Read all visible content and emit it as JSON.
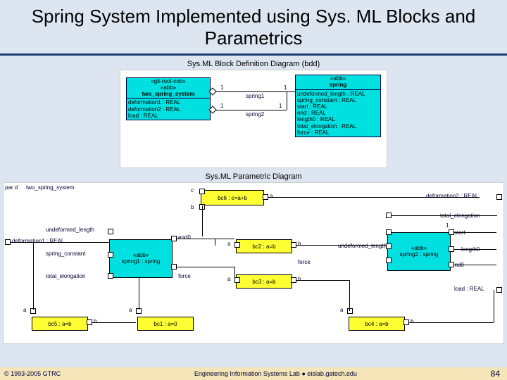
{
  "title": "Spring System Implemented using Sys. ML Blocks and Parametrics",
  "caption_bdd": "Sys.ML Block Definition Diagram (bdd)",
  "caption_par": "Sys.ML Parametric Diagram",
  "bdd": {
    "left_block": {
      "stereo1": "«git-root-cob»",
      "stereo2": "«abb»",
      "name": "two_spring_system",
      "attrs": [
        "deformation1 : REAL",
        "deformation2 : REAL",
        "load : REAL"
      ]
    },
    "right_block": {
      "stereo": "«abb»",
      "name": "spring",
      "attrs": [
        "undeformed_length : REAL",
        "spring_constant : REAL",
        "start : REAL",
        "end : REAL",
        "length0 : REAL",
        "total_elongation : REAL",
        "force : REAL"
      ]
    },
    "assoc": {
      "spring1": "spring1",
      "spring2": "spring2",
      "one_a": "1",
      "one_b": "1",
      "one_c": "1",
      "one_d": "1"
    }
  },
  "par": {
    "frame": "par  d",
    "context": "two_spring_system",
    "left_values": {
      "def1": "deformation1 : REAL",
      "undef": "undeformed_length",
      "spring_const": "spring_constant",
      "total_elong": "total_elongation"
    },
    "right_values": {
      "def2": "deformation2 : REAL",
      "total_elong": "total_elongation",
      "start": "start",
      "length0": "length0",
      "end0": "end0",
      "undef": "undeformed_length",
      "load": "load : REAL"
    },
    "spring1": {
      "stereo": "«abb»",
      "name": "spring1 : spring"
    },
    "spring2": {
      "stereo": "«abb»",
      "name": "spring2 : spring"
    },
    "bc": {
      "bc1": "bc1 : a=0",
      "bc2": "bc2 : a=b",
      "bc3": "bc3 : a=b",
      "bc4": "bc4 : a=b",
      "bc5": "bc5 : a=b",
      "bc6": "bc6 : c=a+b"
    },
    "ports": {
      "a": "a",
      "b": "b",
      "c": "c",
      "end0": "end0",
      "force": "force",
      "one": "1"
    }
  },
  "footer": {
    "left": "© 1993-2005 GTRC",
    "center": "Engineering Information Systems Lab  ●  eislab.gatech.edu",
    "right": "84"
  }
}
